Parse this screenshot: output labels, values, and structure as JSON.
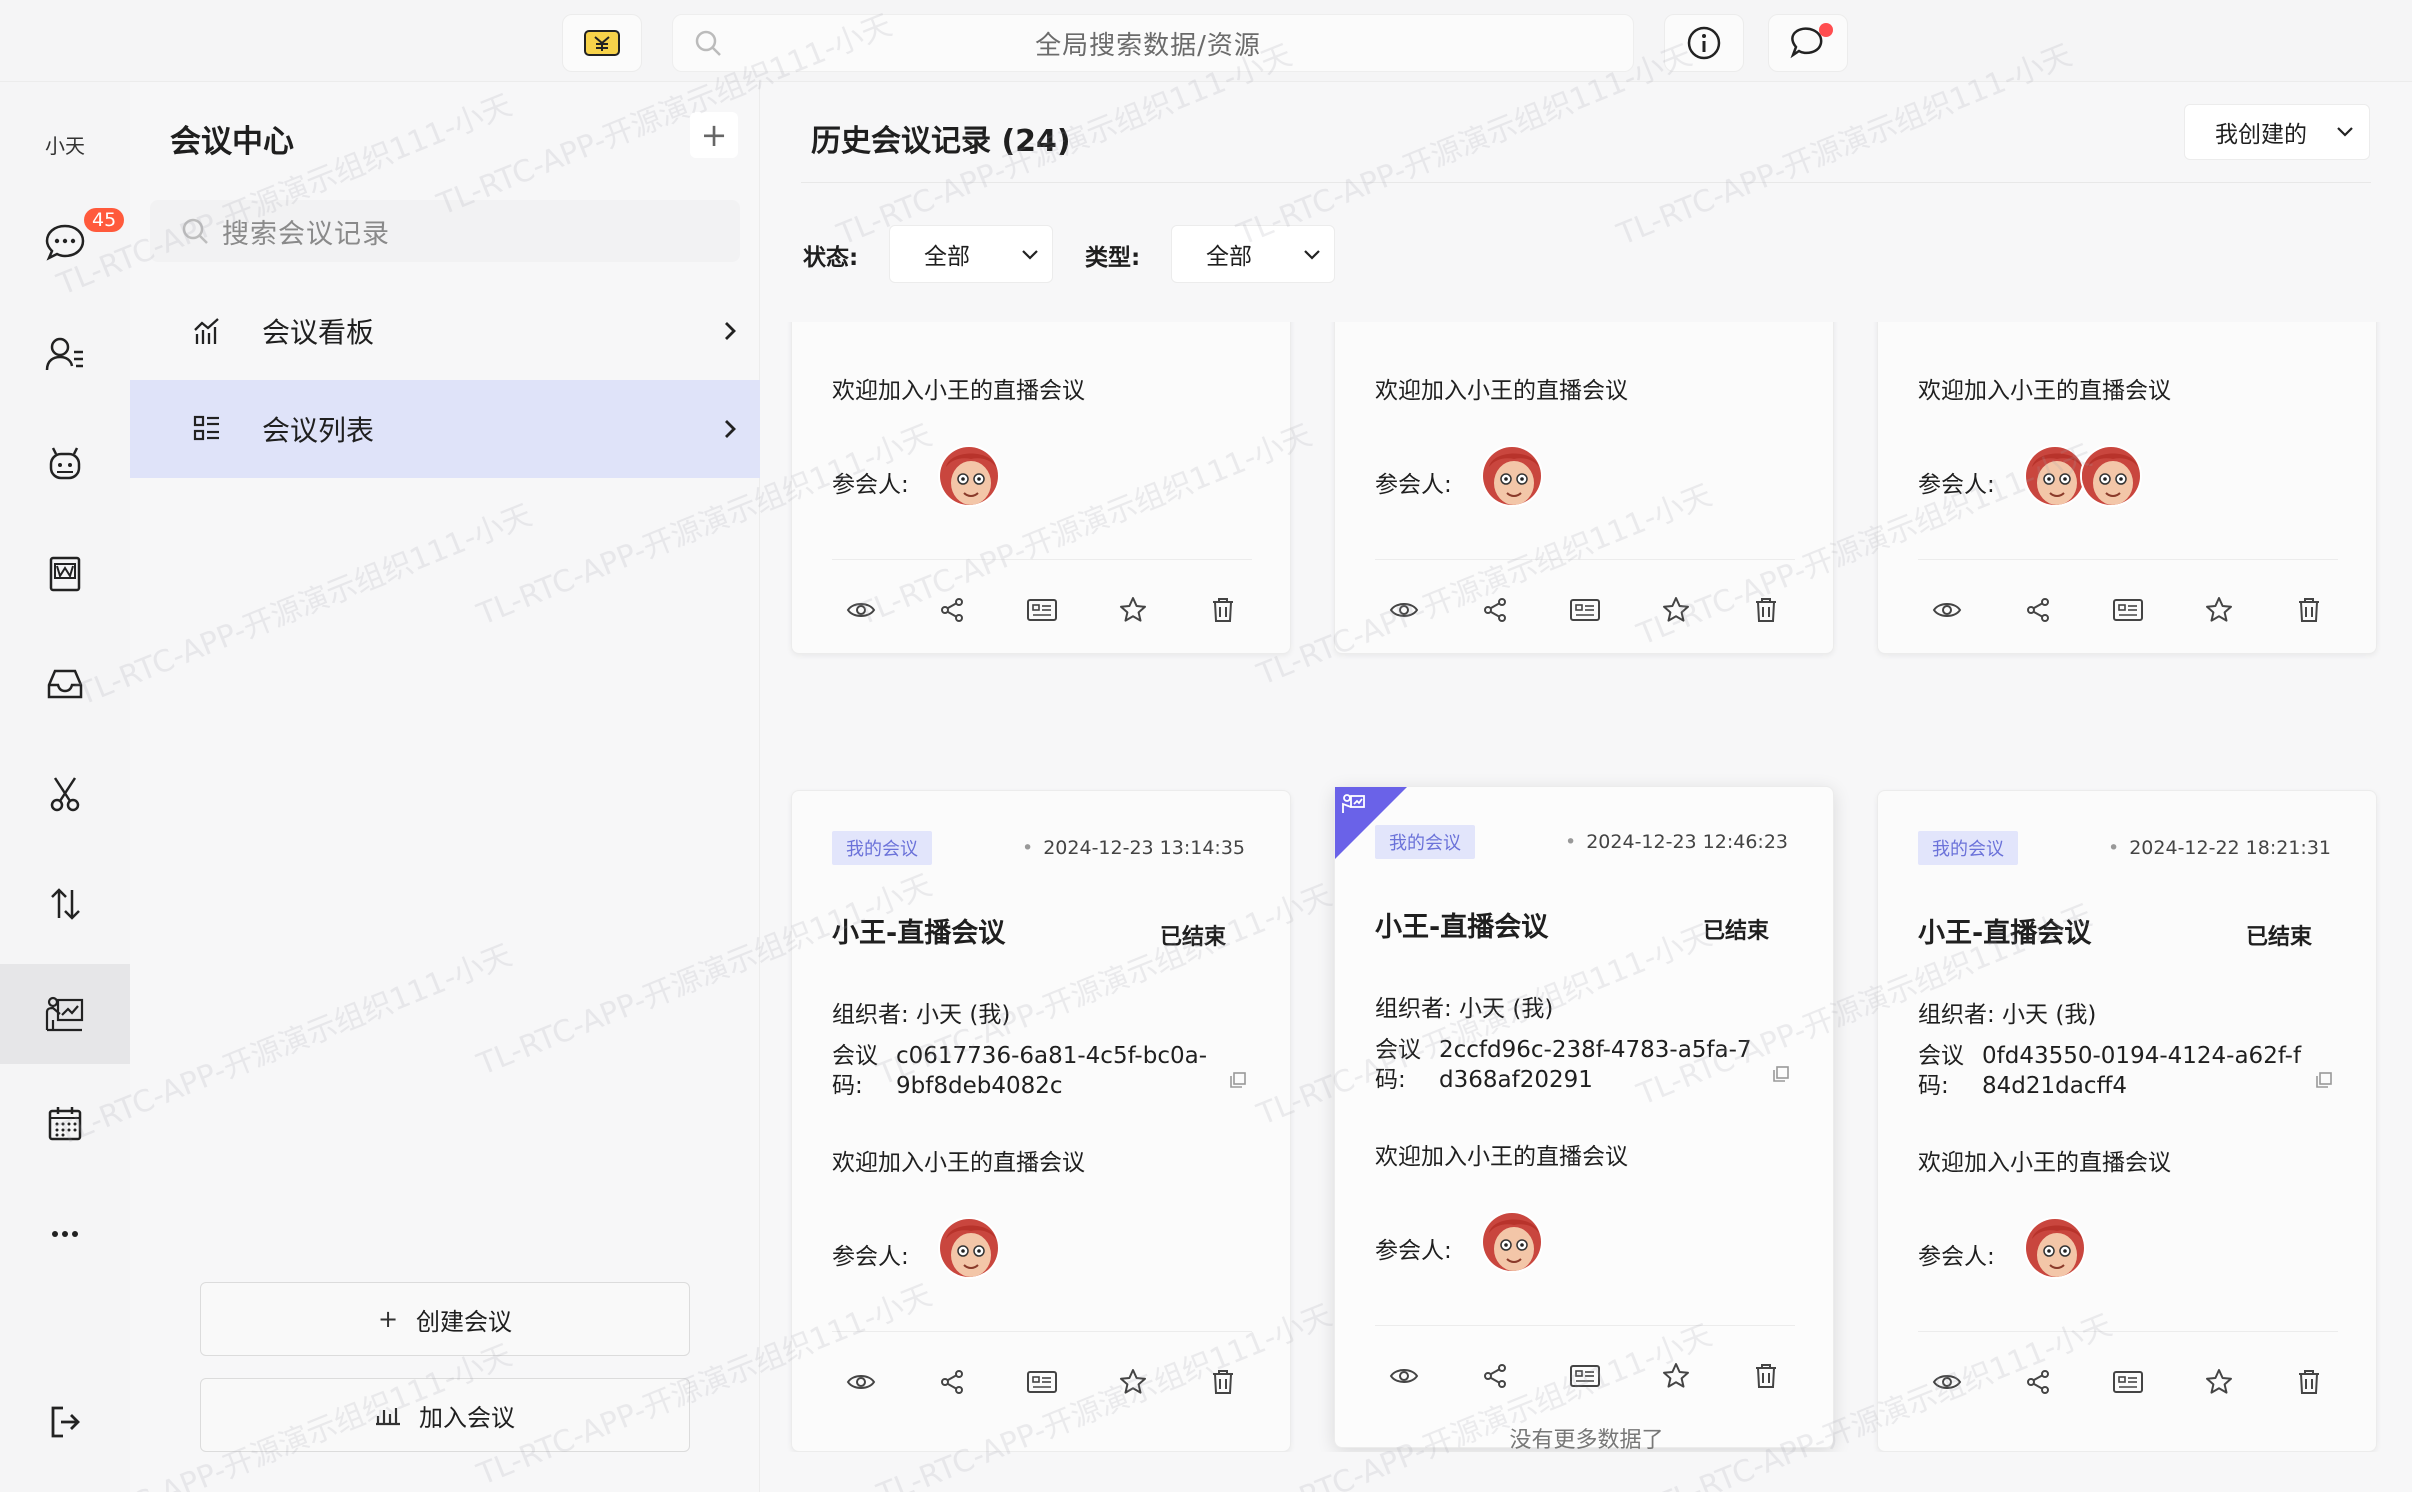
{
  "topbar": {
    "search_placeholder": "全局搜索数据/资源"
  },
  "rail": {
    "user": "小天",
    "chat_badge": "45",
    "items": [
      "chat-icon",
      "contacts-icon",
      "robot-icon",
      "word-doc-icon",
      "inbox-icon",
      "scissors-icon",
      "transfer-icon",
      "meeting-icon",
      "calendar-icon",
      "more-icon"
    ]
  },
  "sidebar": {
    "title": "会议中心",
    "add_label": "+",
    "search_placeholder": "搜索会议记录",
    "items": [
      {
        "label": "会议看板",
        "icon": "chart-icon"
      },
      {
        "label": "会议列表",
        "icon": "list-icon"
      }
    ],
    "create_prefix": "+",
    "create_label": "创建会议",
    "join_label": "加入会议"
  },
  "main": {
    "title": "历史会议记录 (24)",
    "scope_select": "我创建的",
    "status_label": "状态:",
    "status_value": "全部",
    "type_label": "类型:",
    "type_value": "全部",
    "no_more": "没有更多数据了",
    "top_cards": [
      {
        "desc": "欢迎加入小王的直播会议",
        "participants_label": "参会人:",
        "avatar_count": 1
      },
      {
        "desc": "欢迎加入小王的直播会议",
        "participants_label": "参会人:",
        "avatar_count": 1
      },
      {
        "desc": "欢迎加入小王的直播会议",
        "participants_label": "参会人:",
        "avatar_count": 2
      }
    ],
    "cards": [
      {
        "tag": "我的会议",
        "time": "2024-12-23 13:14:35",
        "title": "小王-直播会议",
        "status": "已结束",
        "organizer": "组织者: 小天 (我)",
        "code_label": "会议码:",
        "code": "c0617736-6a81-4c5f-bc0a-9bf8deb4082c",
        "desc": "欢迎加入小王的直播会议",
        "participants_label": "参会人:"
      },
      {
        "tag": "我的会议",
        "time": "2024-12-23 12:46:23",
        "title": "小王-直播会议",
        "status": "已结束",
        "organizer": "组织者: 小天 (我)",
        "code_label": "会议码:",
        "code": "2ccfd96c-238f-4783-a5fa-7d368af20291",
        "desc": "欢迎加入小王的直播会议",
        "participants_label": "参会人:"
      },
      {
        "tag": "我的会议",
        "time": "2024-12-22 18:21:31",
        "title": "小王-直播会议",
        "status": "已结束",
        "organizer": "组织者: 小天 (我)",
        "code_label": "会议码:",
        "code": "0fd43550-0194-4124-a62f-f84d21dacff4",
        "desc": "欢迎加入小王的直播会议",
        "participants_label": "参会人:"
      }
    ]
  },
  "watermark": "TL-RTC-APP-开源演示组织111-小天",
  "colors": {
    "accent": "#6b72d9",
    "active_bg": "#dfe3f9",
    "badge": "#ff5a3c",
    "corner": "#6a62e8"
  }
}
